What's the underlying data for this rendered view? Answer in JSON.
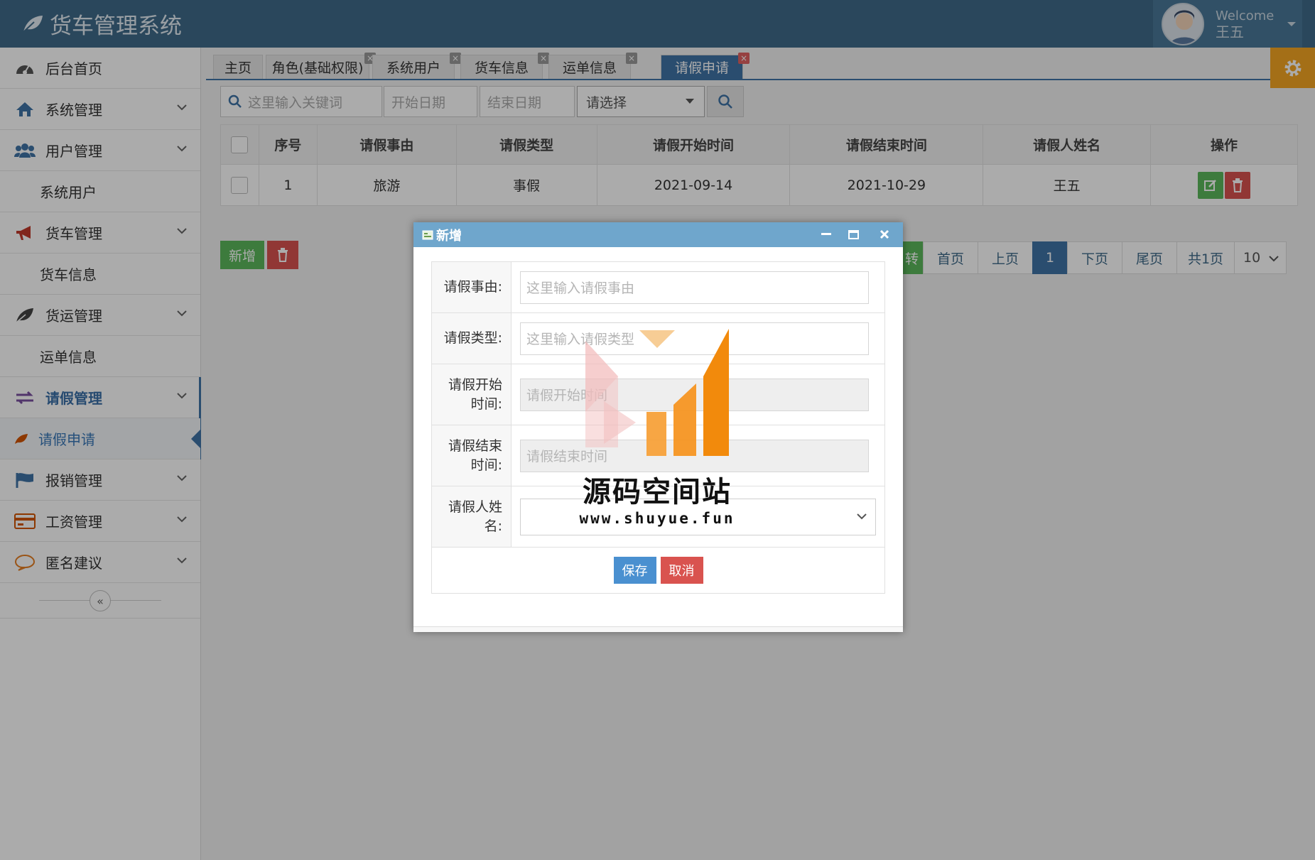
{
  "app": {
    "title": "货车管理系统"
  },
  "user": {
    "welcome": "Welcome",
    "name": "王五"
  },
  "sidebar": {
    "items": [
      {
        "label": "后台首页"
      },
      {
        "label": "系统管理"
      },
      {
        "label": "用户管理"
      },
      {
        "label": "系统用户"
      },
      {
        "label": "货车管理"
      },
      {
        "label": "货车信息"
      },
      {
        "label": "货运管理"
      },
      {
        "label": "运单信息"
      },
      {
        "label": "请假管理"
      },
      {
        "label": "请假申请"
      },
      {
        "label": "报销管理"
      },
      {
        "label": "工资管理"
      },
      {
        "label": "匿名建议"
      }
    ],
    "collapse_glyph": "«"
  },
  "tabs": [
    {
      "label": "主页"
    },
    {
      "label": "角色(基础权限)"
    },
    {
      "label": "系统用户"
    },
    {
      "label": "货车信息"
    },
    {
      "label": "运单信息"
    },
    {
      "label": "请假申请"
    }
  ],
  "tab_close_glyph": "×",
  "toolbar": {
    "keyword_placeholder": "这里输入关键词",
    "start_date_placeholder": "开始日期",
    "end_date_placeholder": "结束日期",
    "select_value": "请选择"
  },
  "table": {
    "headers": [
      "序号",
      "请假事由",
      "请假类型",
      "请假开始时间",
      "请假结束时间",
      "请假人姓名",
      "操作"
    ],
    "rows": [
      {
        "no": "1",
        "reason": "旅游",
        "type": "事假",
        "start": "2021-09-14",
        "end": "2021-10-29",
        "name": "王五"
      }
    ]
  },
  "actions": {
    "add_label": "新增"
  },
  "pager": {
    "go": "转",
    "first": "首页",
    "prev": "上页",
    "current": "1",
    "next": "下页",
    "last": "尾页",
    "total": "共1页",
    "page_size": "10"
  },
  "modal": {
    "title": "新增",
    "fields": [
      {
        "label": "请假事由:",
        "placeholder": "这里输入请假事由"
      },
      {
        "label": "请假类型:",
        "placeholder": "这里输入请假类型"
      },
      {
        "label": "请假开始时间:",
        "placeholder": "请假开始时间"
      },
      {
        "label": "请假结束时间:",
        "placeholder": "请假结束时间"
      },
      {
        "label": "请假人姓名:",
        "placeholder": ""
      }
    ],
    "save_label": "保存",
    "cancel_label": "取消"
  },
  "watermark": {
    "text": "源码空间站",
    "url": "www.shuyue.fun"
  },
  "colors": {
    "header": "#3f6b8a",
    "accent": "#3f73a6",
    "success": "#5cb85c",
    "danger": "#d9534f",
    "warning": "#f5a623"
  }
}
